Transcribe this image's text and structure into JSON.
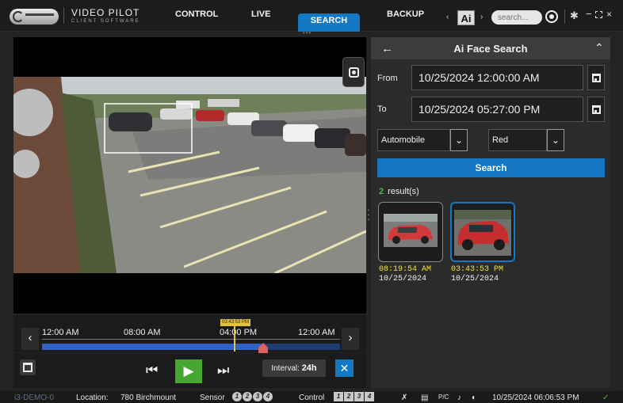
{
  "topbar": {
    "brand_title": "VIDEO PILOT",
    "brand_subtitle": "CLIENT SOFTWARE",
    "nav": {
      "control": "CONTROL",
      "live": "LIVE",
      "search": "SEARCH",
      "backup": "BACKUP"
    },
    "ai_label": "Ai",
    "search_placeholder": "search...",
    "window_controls": {
      "settings": "gear-icon",
      "minimize": "−",
      "maximize": "⬚",
      "close": "×"
    }
  },
  "timeline": {
    "labels": [
      "12:00 AM",
      "08:00 AM",
      "04:00 PM",
      "12:00 AM"
    ],
    "cursor_time": "03:43:53 PM",
    "interval_label": "Interval:",
    "interval_value": "24h"
  },
  "playback": {
    "prev": "⏮",
    "play": "▶",
    "next": "⏭"
  },
  "panel": {
    "title": "Ai Face Search",
    "from_label": "From",
    "from_value": "10/25/2024 12:00:00 AM",
    "to_label": "To",
    "to_value": "10/25/2024 05:27:00 PM",
    "object_type": "Automobile",
    "color": "Red",
    "search_button": "Search",
    "results_count": "2",
    "results_label": "result(s)",
    "results": [
      {
        "time": "08:19:54 AM",
        "date": "10/25/2024",
        "selected": false
      },
      {
        "time": "03:43:53 PM",
        "date": "10/25/2024",
        "selected": true
      }
    ]
  },
  "statusbar": {
    "camera": "i3-DEMO-0",
    "location_label": "Location:",
    "location": "780 Birchmount",
    "sensor_label": "Sensor",
    "sensor_channels": [
      "1",
      "2",
      "3",
      "4"
    ],
    "control_label": "Control",
    "control_channels": [
      "1",
      "2",
      "3",
      "4"
    ],
    "ptz_label": "P/C",
    "datetime": "10/25/2024 06:06:53 PM"
  },
  "colors": {
    "accent": "#1379c4",
    "play": "#45a632",
    "timeline_cursor": "#e2c23a",
    "result_time": "#f2e23a",
    "result_count": "#46b84d"
  }
}
